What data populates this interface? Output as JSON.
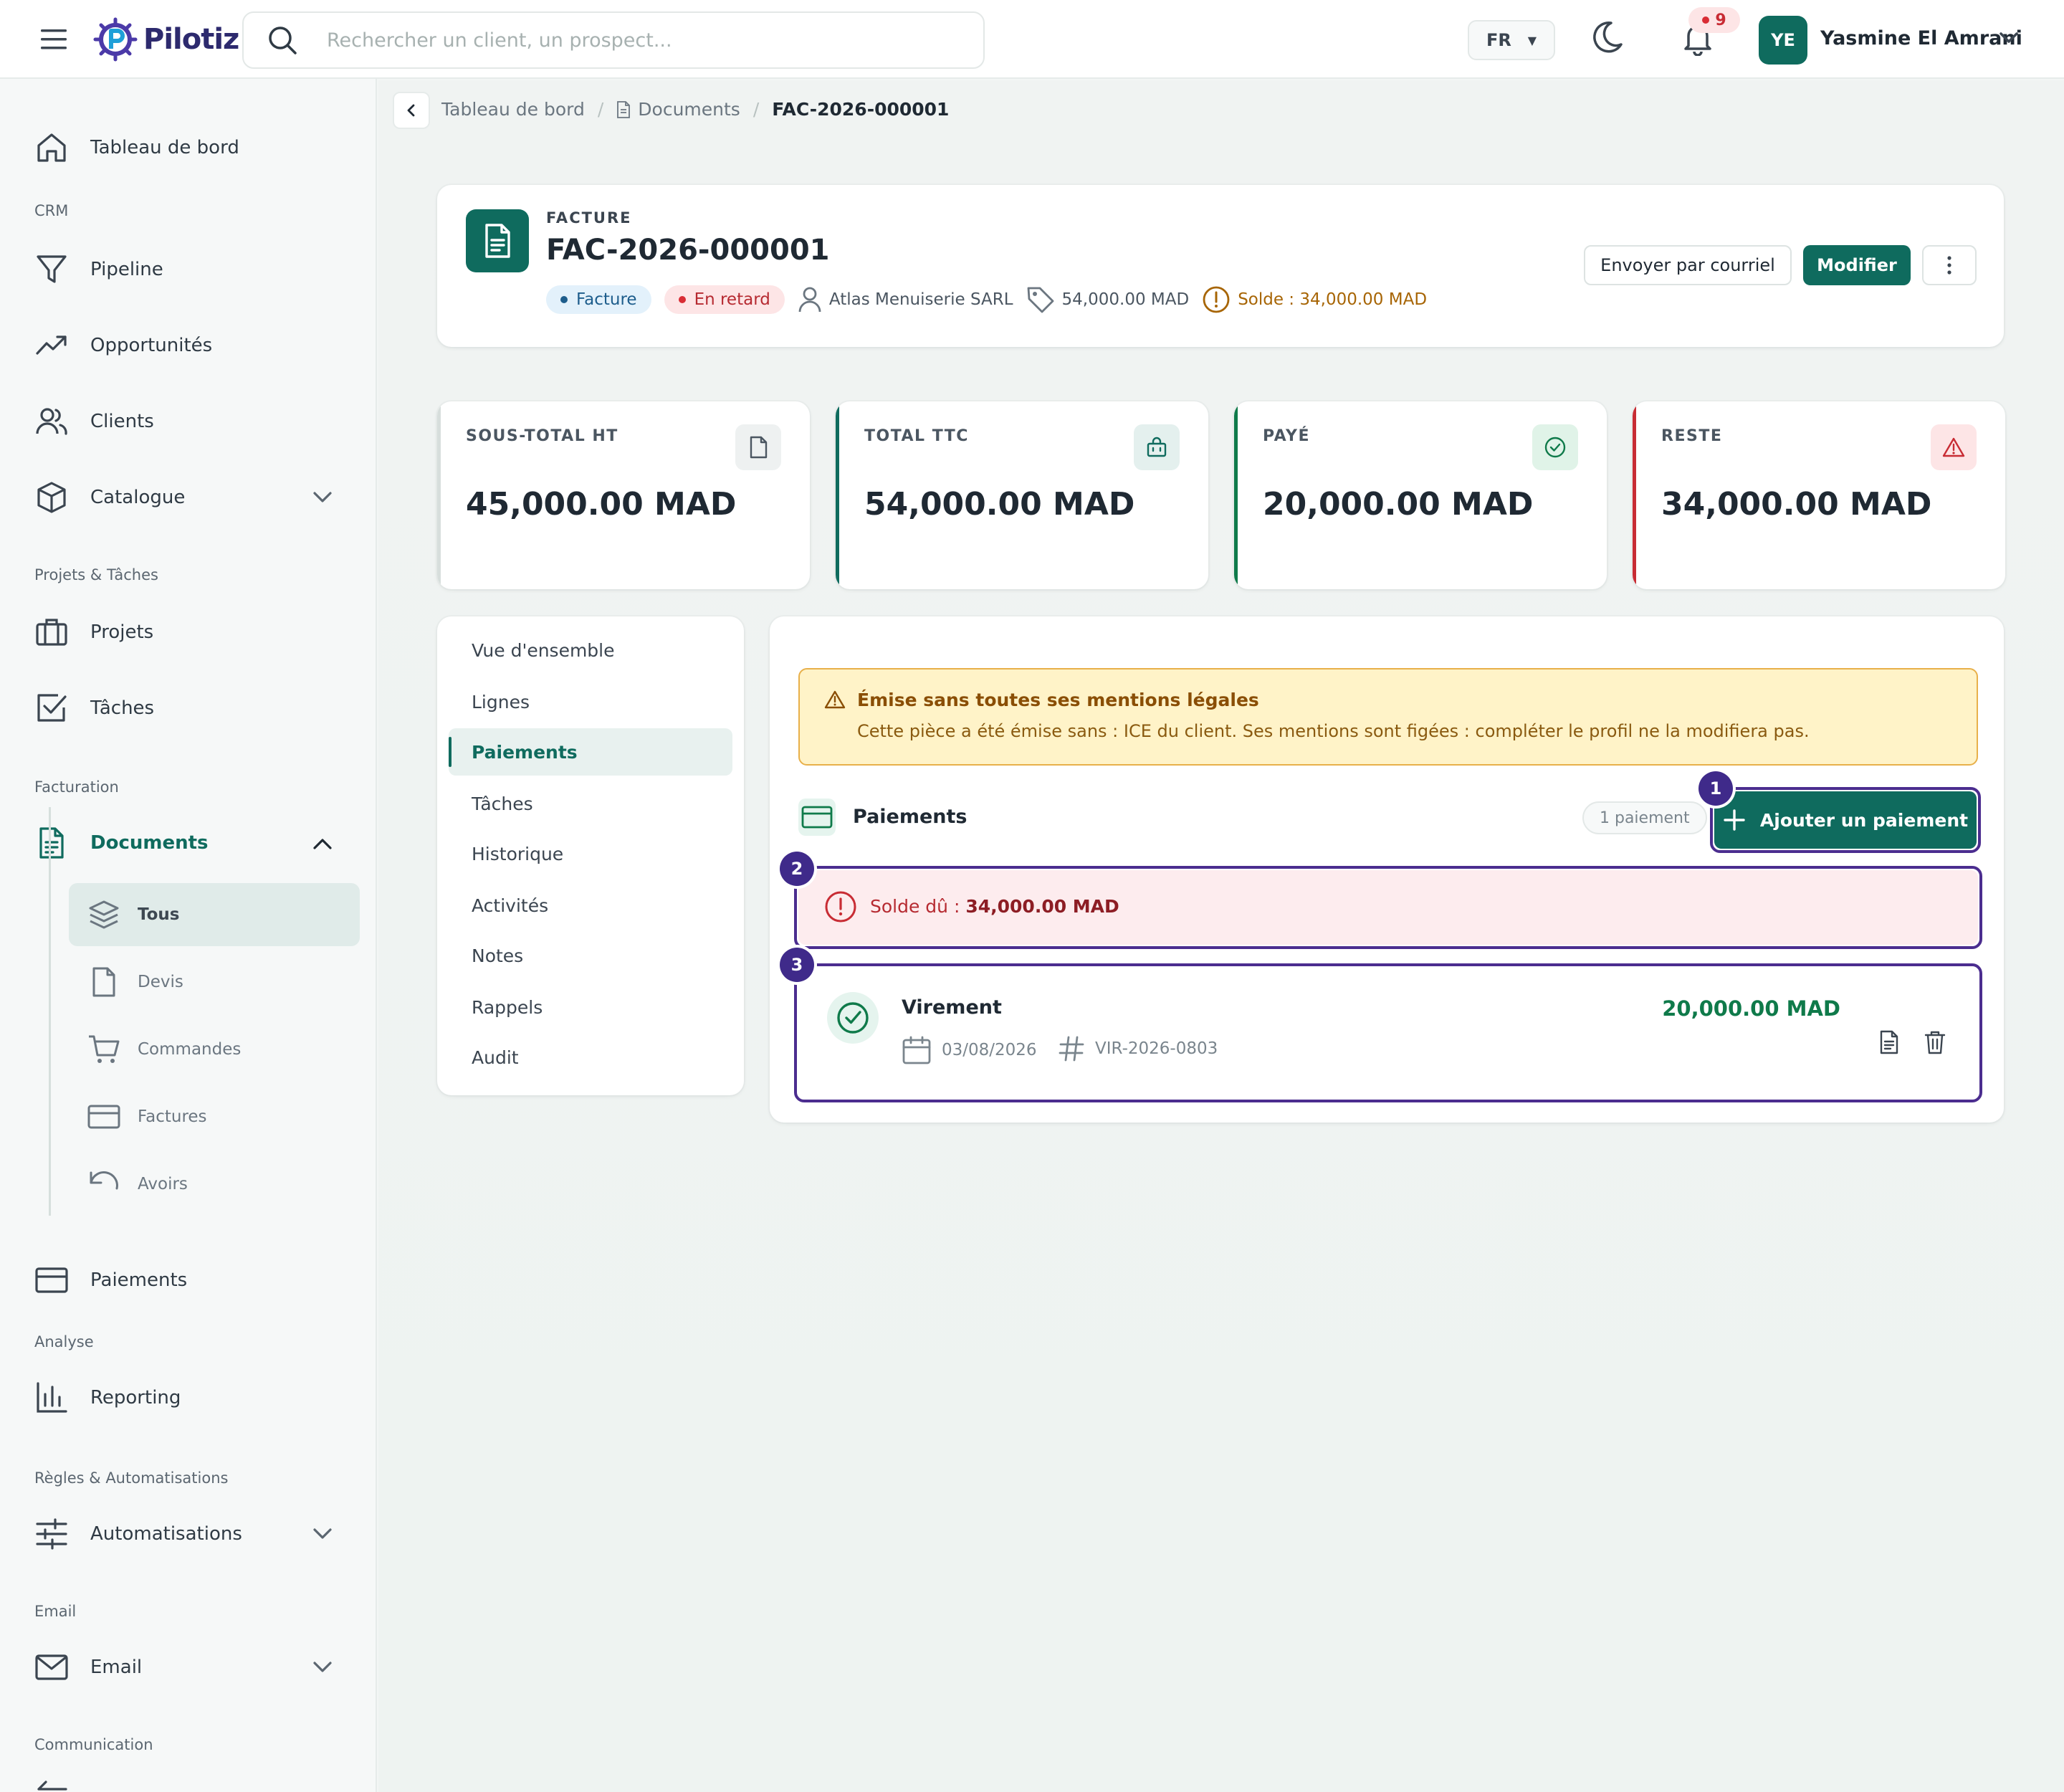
{
  "app": {
    "name": "Pilotiz"
  },
  "topbar": {
    "search_placeholder": "Rechercher un client, un prospect...",
    "language": "FR",
    "notifications_count": "9",
    "user_initials": "YE",
    "user_name": "Yasmine El Amrani"
  },
  "sidebar": {
    "dashboard": "Tableau de bord",
    "sections": {
      "crm": "CRM",
      "projects": "Projets & Tâches",
      "billing": "Facturation",
      "analysis": "Analyse",
      "rules": "Règles & Automatisations",
      "email": "Email",
      "communication": "Communication"
    },
    "items": {
      "pipeline": "Pipeline",
      "opportunities": "Opportunités",
      "clients": "Clients",
      "catalogue": "Catalogue",
      "projects": "Projets",
      "tasks": "Tâches",
      "documents": "Documents",
      "payments": "Paiements",
      "reporting": "Reporting",
      "automations": "Automatisations",
      "email": "Email"
    },
    "documents_sub": {
      "all": "Tous",
      "quotes": "Devis",
      "orders": "Commandes",
      "invoices": "Factures",
      "credits": "Avoirs"
    }
  },
  "breadcrumb": {
    "home": "Tableau de bord",
    "documents": "Documents",
    "current": "FAC-2026-000001"
  },
  "document": {
    "kind": "FACTURE",
    "number": "FAC-2026-000001",
    "type_badge": "Facture",
    "status_badge": "En retard",
    "client": "Atlas Menuiserie SARL",
    "amount": "54,000.00 MAD",
    "balance": "Solde : 34,000.00 MAD",
    "actions": {
      "email": "Envoyer par courriel",
      "edit": "Modifier"
    }
  },
  "stats": [
    {
      "label": "SOUS-TOTAL HT",
      "value": "45,000.00 MAD"
    },
    {
      "label": "TOTAL TTC",
      "value": "54,000.00 MAD"
    },
    {
      "label": "PAYÉ",
      "value": "20,000.00 MAD"
    },
    {
      "label": "RESTE",
      "value": "34,000.00 MAD"
    }
  ],
  "tabs": [
    "Vue d'ensemble",
    "Lignes",
    "Paiements",
    "Tâches",
    "Historique",
    "Activités",
    "Notes",
    "Rappels",
    "Audit"
  ],
  "warning": {
    "title": "Émise sans toutes ses mentions légales",
    "text": "Cette pièce a été émise sans : ICE du client. Ses mentions sont figées : compléter le profil ne la modifiera pas."
  },
  "payments": {
    "title": "Paiements",
    "count": "1 paiement",
    "add_button": "Ajouter un paiement",
    "due_label": "Solde dû :",
    "due_value": "34,000.00 MAD",
    "steps": [
      "1",
      "2",
      "3"
    ],
    "rows": [
      {
        "method": "Virement",
        "date": "03/08/2026",
        "reference": "VIR-2026-0803",
        "amount": "20,000.00 MAD"
      }
    ]
  },
  "colors": {
    "primary": "#0f6b5e",
    "danger": "#c82c34",
    "warning": "#a76505",
    "focus": "#4b2d8f"
  }
}
